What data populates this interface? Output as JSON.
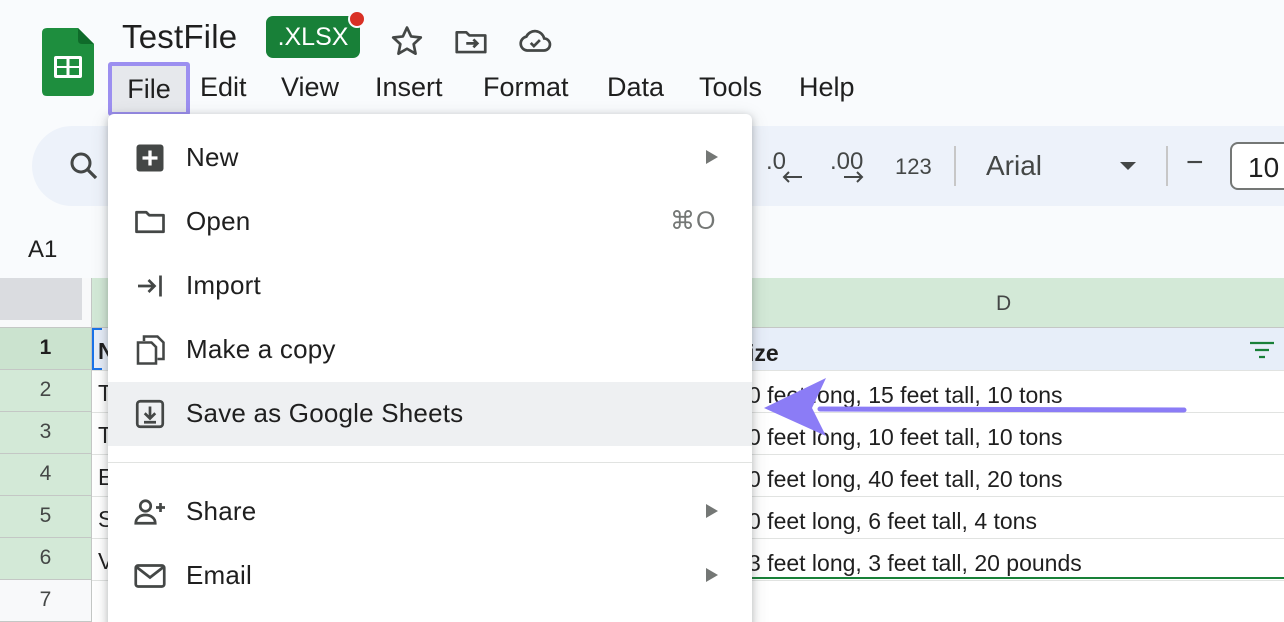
{
  "header": {
    "title": "TestFile",
    "badge": ".XLSX",
    "icons": [
      "star-icon",
      "move-folder-icon",
      "cloud-saved-icon"
    ]
  },
  "menubar": {
    "items": [
      {
        "label": "File",
        "active": true
      },
      {
        "label": "Edit"
      },
      {
        "label": "View"
      },
      {
        "label": "Insert"
      },
      {
        "label": "Format"
      },
      {
        "label": "Data"
      },
      {
        "label": "Tools"
      },
      {
        "label": "Help"
      }
    ]
  },
  "toolbar": {
    "decrease_decimal": ".0",
    "increase_decimal": ".00",
    "number_format": "123",
    "font": "Arial",
    "minus": "−",
    "font_size": "10"
  },
  "namebox": "A1",
  "grid": {
    "column_d_label": "D",
    "rows": [
      {
        "num": "1",
        "a": "N",
        "d": "ize"
      },
      {
        "num": "2",
        "a": "T",
        "d": "0 feet long, 15 feet tall, 10 tons"
      },
      {
        "num": "3",
        "a": "T",
        "d": "0 feet long, 10 feet tall, 10 tons"
      },
      {
        "num": "4",
        "a": "E",
        "d": "0 feet long, 40 feet tall, 20 tons"
      },
      {
        "num": "5",
        "a": "S",
        "d": "0 feet long, 6 feet tall, 4 tons"
      },
      {
        "num": "6",
        "a": "V",
        "d": "3 feet long, 3 feet tall, 20 pounds"
      },
      {
        "num": "7",
        "a": "",
        "d": ""
      }
    ]
  },
  "file_menu": {
    "items": [
      {
        "label": "New",
        "icon": "new-sheet-icon",
        "submenu": true
      },
      {
        "label": "Open",
        "icon": "folder-icon",
        "shortcut": "⌘O"
      },
      {
        "label": "Import",
        "icon": "import-icon"
      },
      {
        "label": "Make a copy",
        "icon": "copy-icon"
      },
      {
        "label": "Save as Google Sheets",
        "icon": "save-download-icon",
        "highlighted": true
      },
      {
        "label": "Share",
        "icon": "share-person-icon",
        "submenu": true
      },
      {
        "label": "Email",
        "icon": "email-icon",
        "submenu": true
      }
    ]
  },
  "colors": {
    "accent_purple": "#9c8ff0",
    "sheets_green": "#188038",
    "arrow": "#8b7cf6"
  }
}
